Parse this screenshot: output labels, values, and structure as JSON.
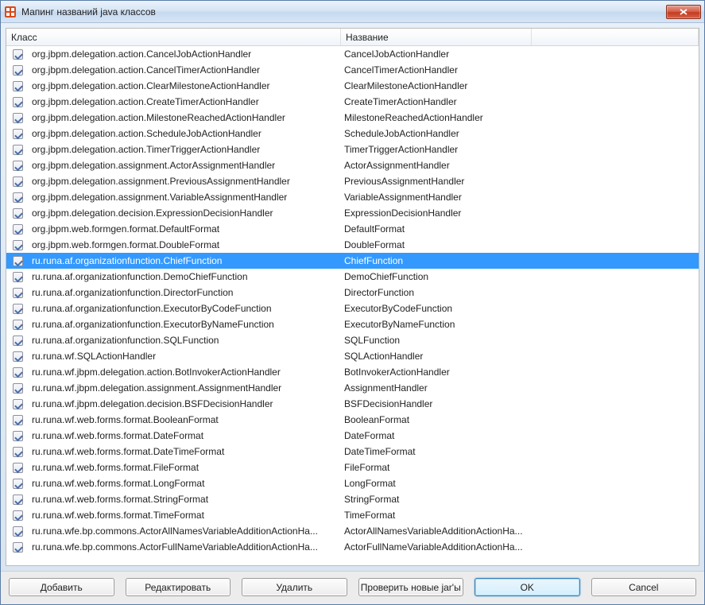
{
  "window": {
    "title": "Мапинг названий java классов"
  },
  "table": {
    "columns": {
      "class": "Класс",
      "name": "Название"
    },
    "selected_index": 13,
    "rows": [
      {
        "checked": true,
        "class": "org.jbpm.delegation.action.CancelJobActionHandler",
        "name": "CancelJobActionHandler"
      },
      {
        "checked": true,
        "class": "org.jbpm.delegation.action.CancelTimerActionHandler",
        "name": "CancelTimerActionHandler"
      },
      {
        "checked": true,
        "class": "org.jbpm.delegation.action.ClearMilestoneActionHandler",
        "name": "ClearMilestoneActionHandler"
      },
      {
        "checked": true,
        "class": "org.jbpm.delegation.action.CreateTimerActionHandler",
        "name": "CreateTimerActionHandler"
      },
      {
        "checked": true,
        "class": "org.jbpm.delegation.action.MilestoneReachedActionHandler",
        "name": "MilestoneReachedActionHandler"
      },
      {
        "checked": true,
        "class": "org.jbpm.delegation.action.ScheduleJobActionHandler",
        "name": "ScheduleJobActionHandler"
      },
      {
        "checked": true,
        "class": "org.jbpm.delegation.action.TimerTriggerActionHandler",
        "name": "TimerTriggerActionHandler"
      },
      {
        "checked": true,
        "class": "org.jbpm.delegation.assignment.ActorAssignmentHandler",
        "name": "ActorAssignmentHandler"
      },
      {
        "checked": true,
        "class": "org.jbpm.delegation.assignment.PreviousAssignmentHandler",
        "name": "PreviousAssignmentHandler"
      },
      {
        "checked": true,
        "class": "org.jbpm.delegation.assignment.VariableAssignmentHandler",
        "name": "VariableAssignmentHandler"
      },
      {
        "checked": true,
        "class": "org.jbpm.delegation.decision.ExpressionDecisionHandler",
        "name": "ExpressionDecisionHandler"
      },
      {
        "checked": true,
        "class": "org.jbpm.web.formgen.format.DefaultFormat",
        "name": "DefaultFormat"
      },
      {
        "checked": true,
        "class": "org.jbpm.web.formgen.format.DoubleFormat",
        "name": "DoubleFormat"
      },
      {
        "checked": true,
        "class": "ru.runa.af.organizationfunction.ChiefFunction",
        "name": "ChiefFunction"
      },
      {
        "checked": true,
        "class": "ru.runa.af.organizationfunction.DemoChiefFunction",
        "name": "DemoChiefFunction"
      },
      {
        "checked": true,
        "class": "ru.runa.af.organizationfunction.DirectorFunction",
        "name": "DirectorFunction"
      },
      {
        "checked": true,
        "class": "ru.runa.af.organizationfunction.ExecutorByCodeFunction",
        "name": "ExecutorByCodeFunction"
      },
      {
        "checked": true,
        "class": "ru.runa.af.organizationfunction.ExecutorByNameFunction",
        "name": "ExecutorByNameFunction"
      },
      {
        "checked": true,
        "class": "ru.runa.af.organizationfunction.SQLFunction",
        "name": "SQLFunction"
      },
      {
        "checked": true,
        "class": "ru.runa.wf.SQLActionHandler",
        "name": "SQLActionHandler"
      },
      {
        "checked": true,
        "class": "ru.runa.wf.jbpm.delegation.action.BotInvokerActionHandler",
        "name": "BotInvokerActionHandler"
      },
      {
        "checked": true,
        "class": "ru.runa.wf.jbpm.delegation.assignment.AssignmentHandler",
        "name": "AssignmentHandler"
      },
      {
        "checked": true,
        "class": "ru.runa.wf.jbpm.delegation.decision.BSFDecisionHandler",
        "name": "BSFDecisionHandler"
      },
      {
        "checked": true,
        "class": "ru.runa.wf.web.forms.format.BooleanFormat",
        "name": "BooleanFormat"
      },
      {
        "checked": true,
        "class": "ru.runa.wf.web.forms.format.DateFormat",
        "name": "DateFormat"
      },
      {
        "checked": true,
        "class": "ru.runa.wf.web.forms.format.DateTimeFormat",
        "name": "DateTimeFormat"
      },
      {
        "checked": true,
        "class": "ru.runa.wf.web.forms.format.FileFormat",
        "name": "FileFormat"
      },
      {
        "checked": true,
        "class": "ru.runa.wf.web.forms.format.LongFormat",
        "name": "LongFormat"
      },
      {
        "checked": true,
        "class": "ru.runa.wf.web.forms.format.StringFormat",
        "name": "StringFormat"
      },
      {
        "checked": true,
        "class": "ru.runa.wf.web.forms.format.TimeFormat",
        "name": "TimeFormat"
      },
      {
        "checked": true,
        "class": "ru.runa.wfe.bp.commons.ActorAllNamesVariableAdditionActionHa...",
        "name": "ActorAllNamesVariableAdditionActionHa..."
      },
      {
        "checked": true,
        "class": "ru.runa.wfe.bp.commons.ActorFullNameVariableAdditionActionHa...",
        "name": "ActorFullNameVariableAdditionActionHa..."
      }
    ]
  },
  "buttons": {
    "add": "Добавить",
    "edit": "Редактировать",
    "delete": "Удалить",
    "check": "Проверить новые jar'ы",
    "ok": "OK",
    "cancel": "Cancel"
  }
}
